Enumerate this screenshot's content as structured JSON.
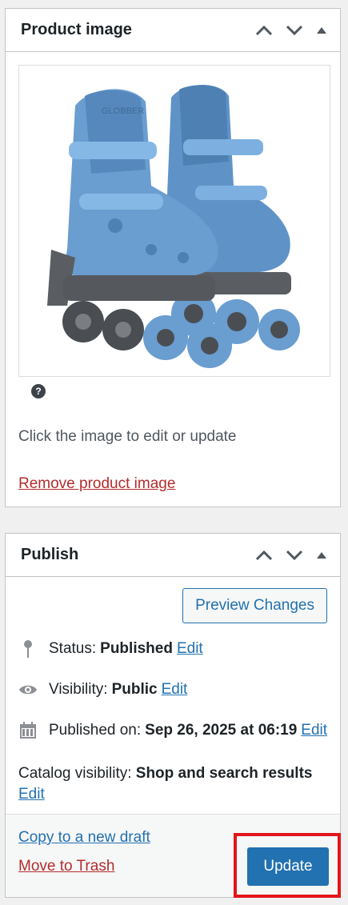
{
  "product_image_box": {
    "title": "Product image",
    "hint": "Click the image to edit or update",
    "remove_link": "Remove product image",
    "image_alt": "Blue inline skates",
    "image_brand_text": "GLOBBER",
    "icons": {
      "up": "chevron-up-icon",
      "down": "chevron-down-icon",
      "toggle": "triangle-up-icon",
      "help": "help-icon"
    }
  },
  "publish_box": {
    "title": "Publish",
    "preview_button": "Preview Changes",
    "status": {
      "label": "Status:",
      "value": "Published",
      "edit": "Edit",
      "icon": "pin-icon"
    },
    "visibility": {
      "label": "Visibility:",
      "value": "Public",
      "edit": "Edit",
      "icon": "eye-icon"
    },
    "published_on": {
      "label": "Published on:",
      "value": "Sep 26, 2025 at 06:19",
      "edit": "Edit",
      "icon": "calendar-icon"
    },
    "catalog_visibility": {
      "label": "Catalog visibility:",
      "value": "Shop and search results",
      "edit": "Edit"
    },
    "copy_link": "Copy to a new draft",
    "trash_link": "Move to Trash",
    "update_button": "Update"
  },
  "colors": {
    "accent": "#2271b1",
    "danger": "#b32d2e",
    "highlight": "#e3141c",
    "skate_blue": "#6a9dd0"
  }
}
